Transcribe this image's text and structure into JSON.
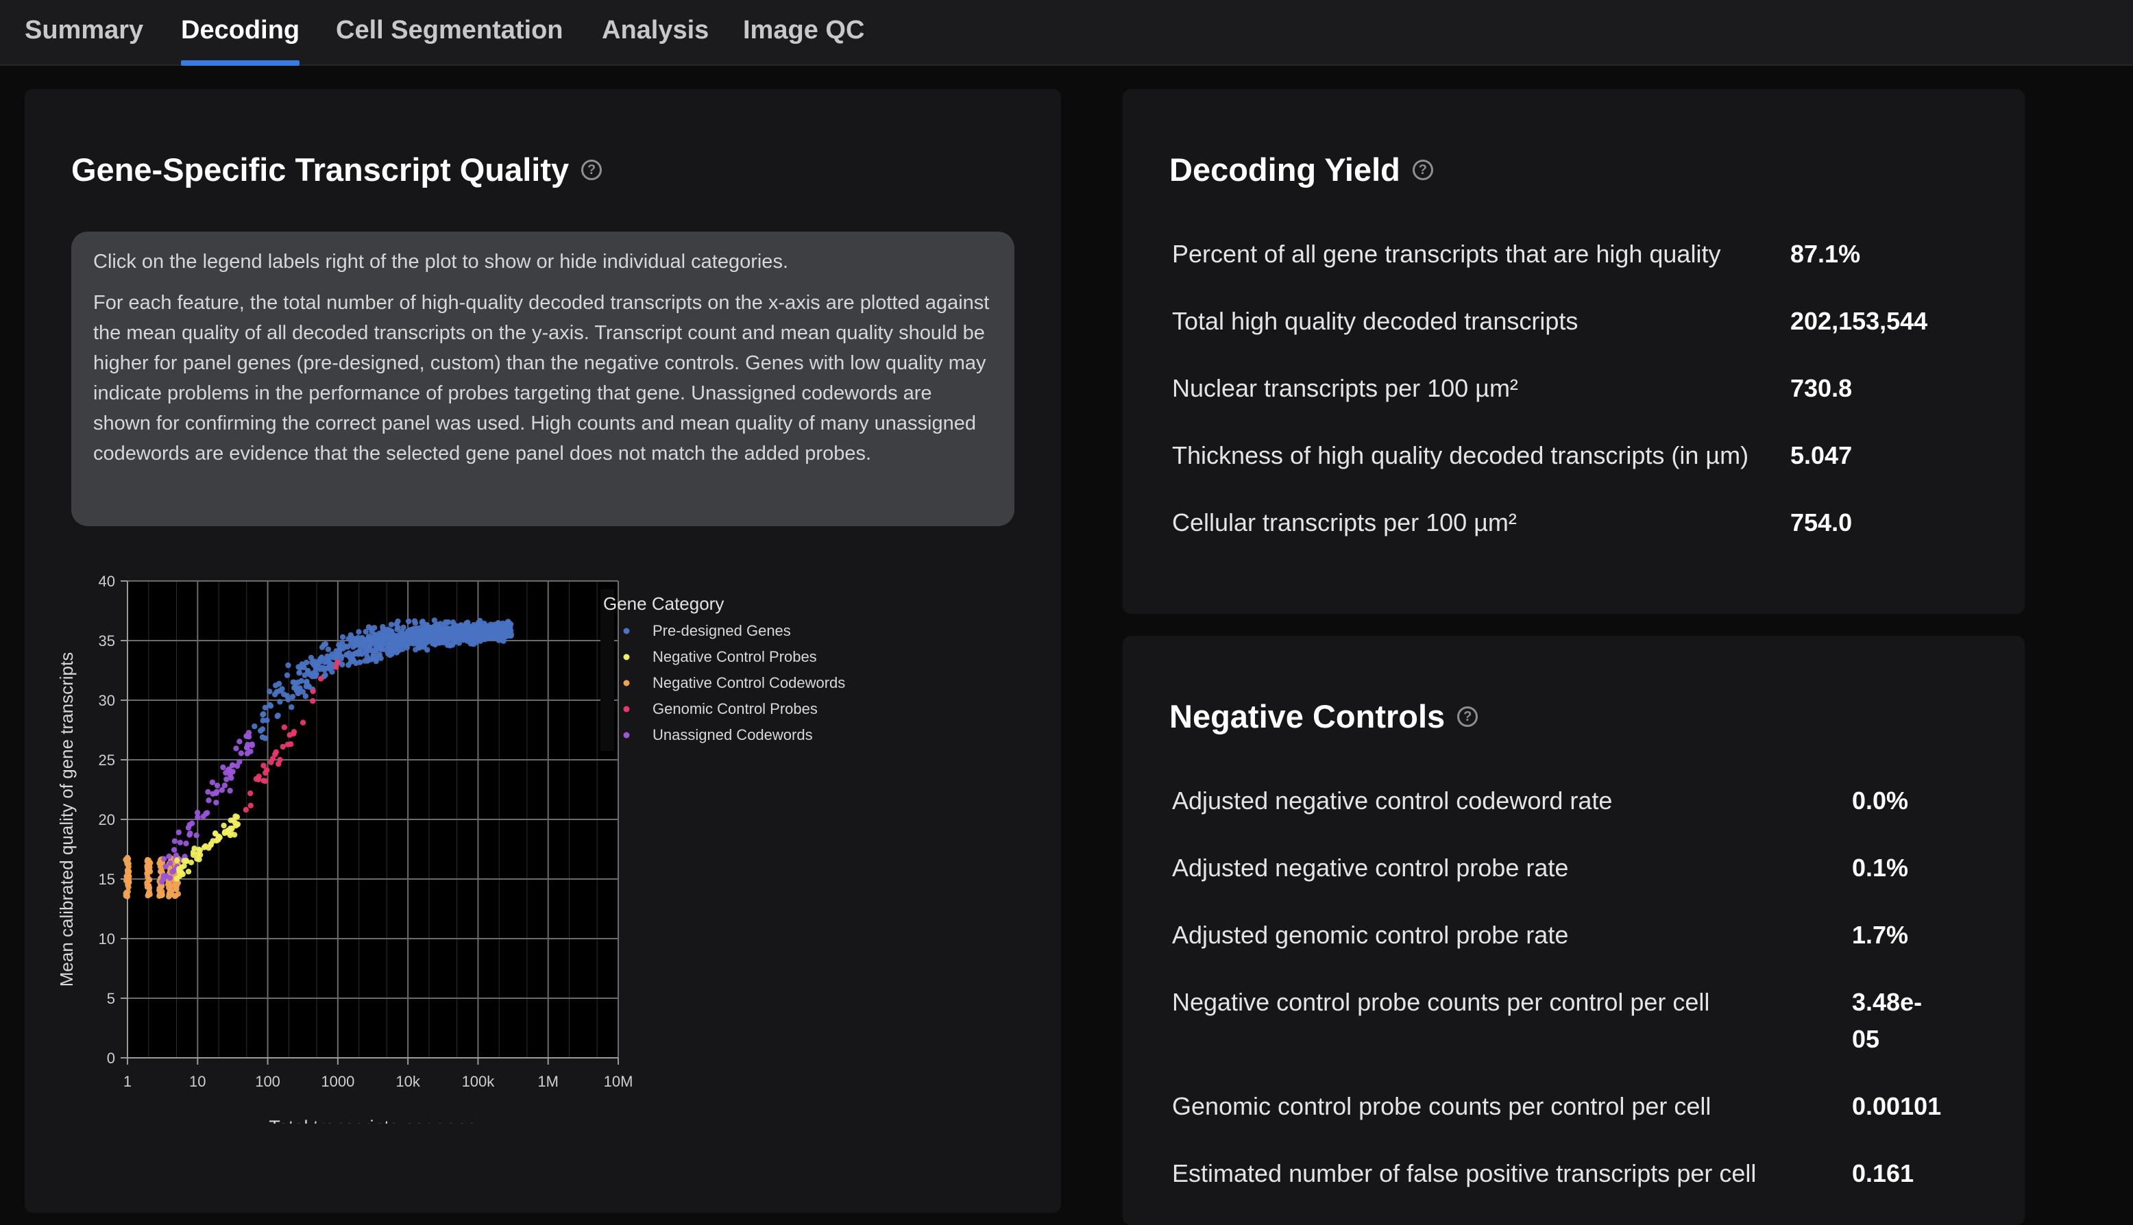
{
  "tabs": [
    {
      "label": "Summary",
      "active": false
    },
    {
      "label": "Decoding",
      "active": true
    },
    {
      "label": "Cell Segmentation",
      "active": false
    },
    {
      "label": "Analysis",
      "active": false
    },
    {
      "label": "Image QC",
      "active": false
    }
  ],
  "quality_panel": {
    "title": "Gene-Specific Transcript Quality",
    "help_icon": "question-circle-icon",
    "info_line1": "Click on the legend labels right of the plot to show or hide individual categories.",
    "info_line2": "For each feature, the total number of high-quality decoded transcripts on the x-axis are plotted against the mean quality of all decoded transcripts on the y-axis. Transcript count and mean quality should be higher for panel genes (pre-designed, custom) than the negative controls. Genes with low quality may indicate problems in the performance of probes targeting that gene. Unassigned codewords are shown for confirming the correct panel was used. High counts and mean quality of many unassigned codewords are evidence that the selected gene panel does not match the added probes."
  },
  "chart_data": {
    "type": "scatter",
    "xlabel": "Total transcripts per gene",
    "ylabel": "Mean calibrated quality of gene transcripts",
    "x_scale": "log",
    "xlim": [
      1,
      10000000
    ],
    "ylim": [
      0,
      40
    ],
    "x_ticks": [
      "1",
      "10",
      "100",
      "1000",
      "10k",
      "100k",
      "1M",
      "10M"
    ],
    "y_ticks": [
      "0",
      "5",
      "10",
      "15",
      "20",
      "25",
      "30",
      "35",
      "40"
    ],
    "grid": true,
    "legend_title": "Gene Category",
    "legend_position": "top-right",
    "series": [
      {
        "name": "Pre-designed Genes",
        "color": "#4a73c2",
        "x_range": [
          60,
          300000
        ],
        "y_range": [
          26,
          37
        ]
      },
      {
        "name": "Negative Control Probes",
        "color": "#f0ee62",
        "x_range": [
          5,
          40
        ],
        "y_range": [
          15,
          21
        ]
      },
      {
        "name": "Negative Control Codewords",
        "color": "#f0a254",
        "x_values": [
          1,
          2,
          3,
          4,
          5
        ],
        "y_range": [
          13.5,
          19
        ]
      },
      {
        "name": "Genomic Control Probes",
        "color": "#e8386e",
        "x_range": [
          40,
          1000
        ],
        "y_range": [
          19,
          34
        ]
      },
      {
        "name": "Unassigned Codewords",
        "color": "#9a55d8",
        "x_range": [
          3,
          60
        ],
        "y_range": [
          14,
          32
        ]
      }
    ]
  },
  "decoding_yield": {
    "title": "Decoding Yield",
    "help_icon": "question-circle-icon",
    "rows": [
      {
        "label": "Percent of all gene transcripts that are high quality",
        "value": "87.1%"
      },
      {
        "label": "Total high quality decoded transcripts",
        "value": "202,153,544"
      },
      {
        "label": "Nuclear transcripts per 100 µm²",
        "value": "730.8"
      },
      {
        "label": "Thickness of high quality decoded transcripts (in µm)",
        "value": "5.047"
      },
      {
        "label": "Cellular transcripts per 100 µm²",
        "value": "754.0"
      }
    ]
  },
  "negative_controls": {
    "title": "Negative Controls",
    "help_icon": "question-circle-icon",
    "rows": [
      {
        "label": "Adjusted negative control codeword rate",
        "value": "0.0%"
      },
      {
        "label": "Adjusted negative control probe rate",
        "value": "0.1%"
      },
      {
        "label": "Adjusted genomic control probe rate",
        "value": "1.7%"
      },
      {
        "label": "Negative control probe counts per control per cell",
        "value": "3.48e-",
        "value_line2": "05"
      },
      {
        "label": "Genomic control probe counts per control per cell",
        "value": "0.00101"
      },
      {
        "label": "Estimated number of false positive transcripts per cell",
        "value": "0.161"
      }
    ]
  }
}
